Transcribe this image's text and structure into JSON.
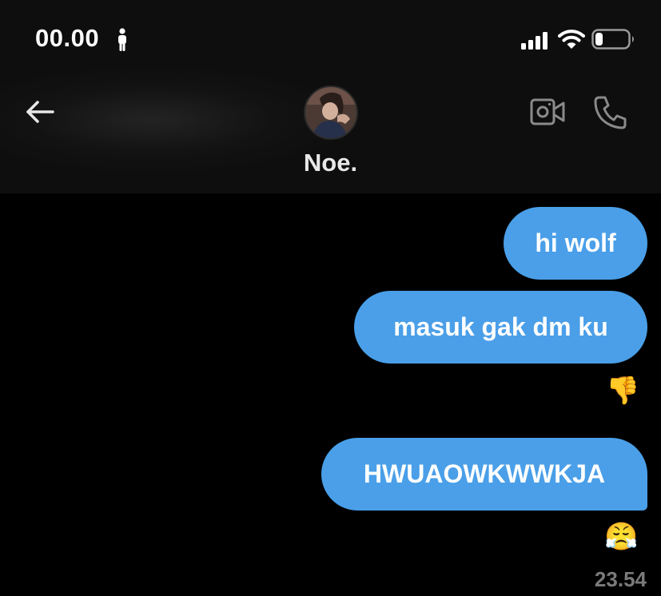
{
  "status_bar": {
    "time": "00.00",
    "person_icon": "person-icon",
    "signal_icon": "cellular-signal-icon",
    "wifi_icon": "wifi-icon",
    "battery_icon": "battery-low-icon",
    "battery_level": 0.2
  },
  "header": {
    "back_icon": "arrow-left-icon",
    "contact_name": "Noe.",
    "video_icon": "video-camera-icon",
    "call_icon": "phone-icon"
  },
  "messages": [
    {
      "text": "hi wolf",
      "sender": "me"
    },
    {
      "text": "masuk gak dm ku",
      "sender": "me",
      "reaction": "👎"
    },
    {
      "text": "HWUAOWKWWKJA",
      "sender": "me",
      "reaction": "😤"
    }
  ],
  "timestamp": "23.54",
  "colors": {
    "bubble": "#4a9fe8",
    "background": "#000000",
    "header": "#121212",
    "timestamp": "#7a7a7a"
  }
}
